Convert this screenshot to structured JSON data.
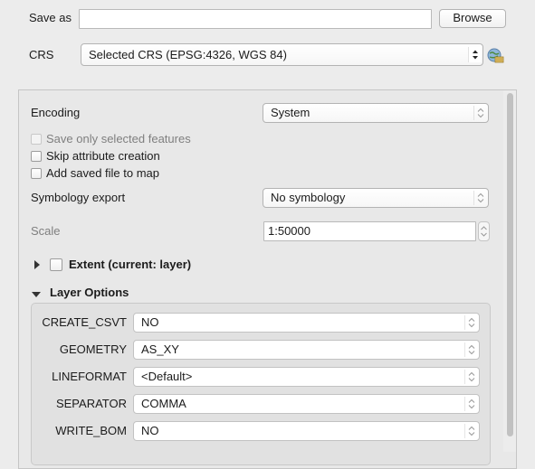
{
  "save_as": {
    "label": "Save as",
    "value": "",
    "browse_label": "Browse"
  },
  "crs": {
    "label": "CRS",
    "selected": "Selected CRS (EPSG:4326, WGS 84)"
  },
  "encoding": {
    "label": "Encoding",
    "value": "System"
  },
  "checkboxes": {
    "save_selected": "Save only selected features",
    "skip_attr": "Skip attribute creation",
    "add_to_map": "Add saved file to map"
  },
  "symbology": {
    "label": "Symbology export",
    "value": "No symbology"
  },
  "scale": {
    "label": "Scale",
    "value": "1:50000"
  },
  "extent": {
    "label": "Extent (current: layer)"
  },
  "layer_options": {
    "title": "Layer Options",
    "items": [
      {
        "label": "CREATE_CSVT",
        "value": "NO"
      },
      {
        "label": "GEOMETRY",
        "value": "AS_XY"
      },
      {
        "label": "LINEFORMAT",
        "value": "<Default>"
      },
      {
        "label": "SEPARATOR",
        "value": "COMMA"
      },
      {
        "label": "WRITE_BOM",
        "value": "NO"
      }
    ]
  }
}
